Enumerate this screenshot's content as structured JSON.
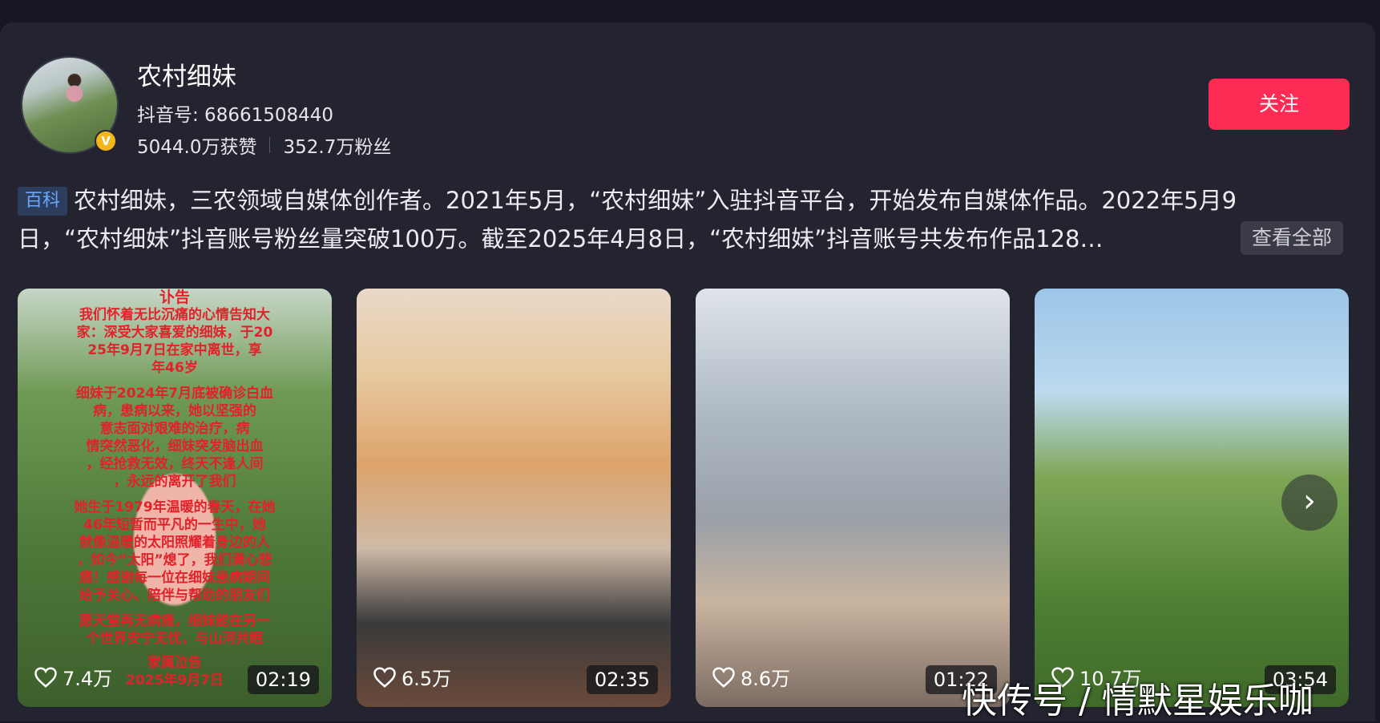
{
  "profile": {
    "name": "农村细妹",
    "douyin_id": "抖音号: 68661508440",
    "likes": "5044.0万获赞",
    "fans": "352.7万粉丝",
    "verified_mark": "V",
    "follow_label": "关注"
  },
  "bio": {
    "tag": "百科",
    "line1": "农村细妹，三农领域自媒体创作者。2021年5月，“农村细妹”入驻抖音平台，开始发布自媒体作品。2022年5月9",
    "line2": "日，“农村细妹”抖音账号粉丝量突破100万。截至2025年4月8日，“农村细妹”抖音账号共发布作品128…",
    "more_label": "查看全部"
  },
  "videos": [
    {
      "likes": "7.4万",
      "duration": "02:19",
      "overlay_lines": [
        "讣告",
        "我们怀着无比沉痛的心情告知大",
        "家：深受大家喜爱的细妹，于20",
        "25年9月7日在家中离世，享",
        "年46岁",
        "细妹于2024年7月底被确诊白血",
        "病，患病以来，她以坚强的",
        "意志面对艰难的治疗，病",
        "情突然恶化，细妹突发脑出血",
        "，经抢救无效，终天不逢人间",
        "，永远的离开了我们",
        "她生于1979年温暖的春天，在她",
        "46年短暂而平凡的一生中，她",
        "就像温暖的太阳照耀着身边的人",
        "，如今“太阳”熄了，我们满心悲",
        "痛！感谢每一位在细妹患病期间",
        "给予关心、陪伴与帮助的朋友们",
        "愿天堂再无病痛，细妹能在另一",
        "个世界安宁无忧，与山河共眠",
        "家属泣告",
        "2025年9月7日"
      ]
    },
    {
      "likes": "6.5万",
      "duration": "02:35"
    },
    {
      "likes": "8.6万",
      "duration": "01:22"
    },
    {
      "likes": "10.7万",
      "duration": "03:54"
    }
  ],
  "next_arrow": "›",
  "watermark": "快传号 / 情默星娱乐咖",
  "colors": {
    "follow": "#fe2c55",
    "tag_text": "#6aa8ff",
    "card_bg": "#23242f"
  }
}
